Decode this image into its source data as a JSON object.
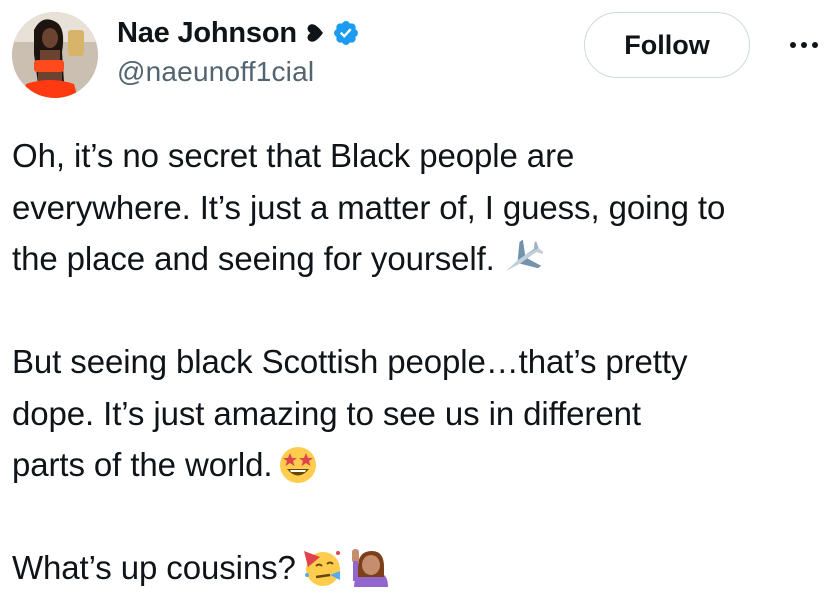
{
  "author": {
    "display_name": "Nae Johnson",
    "handle": "@naeunoff1cial",
    "verified": true,
    "name_icon": "black-heart-icon",
    "badge_icon": "verified-badge-icon"
  },
  "actions": {
    "follow_label": "Follow",
    "more_icon": "more-options-icon"
  },
  "tweet": {
    "paragraphs": [
      {
        "lines": [
          "Oh, it’s no secret that Black people are",
          "everywhere. It’s just a matter of, I guess, going to",
          "the place and seeing for yourself."
        ],
        "emojis": [
          "airplane-emoji"
        ]
      },
      {
        "lines": [
          "But seeing black Scottish people…that’s pretty",
          "dope. It’s just amazing to see us in different",
          "parts of the world."
        ],
        "emojis": [
          "star-struck-emoji"
        ]
      },
      {
        "lines": [
          "What’s up cousins?"
        ],
        "emojis": [
          "partying-face-emoji",
          "person-raising-hand-emoji"
        ]
      }
    ]
  },
  "colors": {
    "text_primary": "#0f1419",
    "text_secondary": "#536471",
    "verified_blue": "#1d9bf0",
    "follow_border": "#cfd9de"
  }
}
